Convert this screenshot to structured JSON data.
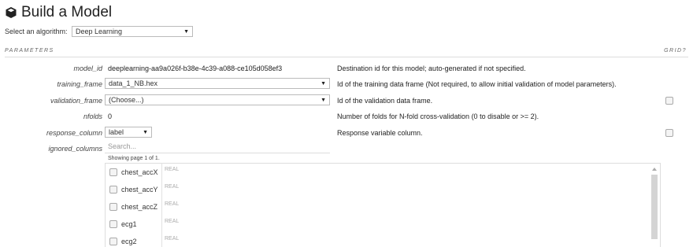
{
  "header": {
    "title": "Build a Model",
    "icon": "cube-icon"
  },
  "algorithm": {
    "label": "Select an algorithm:",
    "value": "Deep Learning"
  },
  "parameters": {
    "section_label": "PARAMETERS",
    "grid_label": "GRID?",
    "model_id": {
      "label": "model_id",
      "value": "deeplearning-aa9a026f-b38e-4c39-a088-ce105d058ef3",
      "description": "Destination id for this model; auto-generated if not specified."
    },
    "training_frame": {
      "label": "training_frame",
      "value": "data_1_NB.hex",
      "description": "Id of the training data frame (Not required, to allow initial validation of model parameters)."
    },
    "validation_frame": {
      "label": "validation_frame",
      "value": "(Choose...)",
      "description": "Id of the validation data frame."
    },
    "nfolds": {
      "label": "nfolds",
      "value": "0",
      "description": "Number of folds for N-fold cross-validation (0 to disable or >= 2)."
    },
    "response_column": {
      "label": "response_column",
      "value": "label",
      "description": "Response variable column."
    },
    "ignored_columns": {
      "label": "ignored_columns",
      "search_placeholder": "Search...",
      "showing": "Showing page 1 of 1.",
      "columns": [
        {
          "name": "chest_accX",
          "type": "REAL"
        },
        {
          "name": "chest_accY",
          "type": "REAL"
        },
        {
          "name": "chest_accZ",
          "type": "REAL"
        },
        {
          "name": "ecg1",
          "type": "REAL"
        },
        {
          "name": "ecg2",
          "type": "REAL"
        }
      ]
    }
  }
}
